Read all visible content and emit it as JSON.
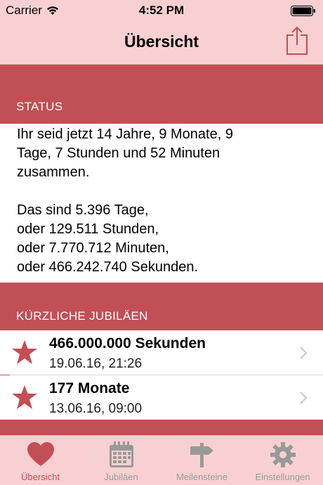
{
  "status_bar": {
    "carrier": "Carrier",
    "time": "4:52 PM"
  },
  "nav": {
    "title": "Übersicht",
    "share_icon": "share-icon"
  },
  "sections": {
    "status_header": "STATUS",
    "jubilees_header": "KÜRZLICHE JUBILÄEN"
  },
  "status": {
    "line1": "Ihr seid jetzt 14 Jahre, 9 Monate, 9",
    "line2": "Tage, 7 Stunden und 52 Minuten",
    "line3": "zusammen.",
    "line4": "Das sind 5.396 Tage,",
    "line5": "oder 129.511 Stunden,",
    "line6": "oder 7.770.712 Minuten,",
    "line7": "oder 466.242.740 Sekunden."
  },
  "jubilees": [
    {
      "title": "466.000.000 Sekunden",
      "date": "19.06.16, 21:26",
      "icon": "star-icon"
    },
    {
      "title": "177 Monate",
      "date": "13.06.16, 09:00",
      "icon": "star-icon"
    }
  ],
  "tabs": [
    {
      "label": "Übersicht",
      "icon": "heart-icon",
      "active": true
    },
    {
      "label": "Jubiläen",
      "icon": "calendar-icon",
      "active": false
    },
    {
      "label": "Meilensteine",
      "icon": "signpost-icon",
      "active": false
    },
    {
      "label": "Einstellungen",
      "icon": "gear-icon",
      "active": false
    }
  ],
  "colors": {
    "accent": "#c24f55",
    "bar_background": "#f9d0d2",
    "inactive_tab": "#999999"
  }
}
